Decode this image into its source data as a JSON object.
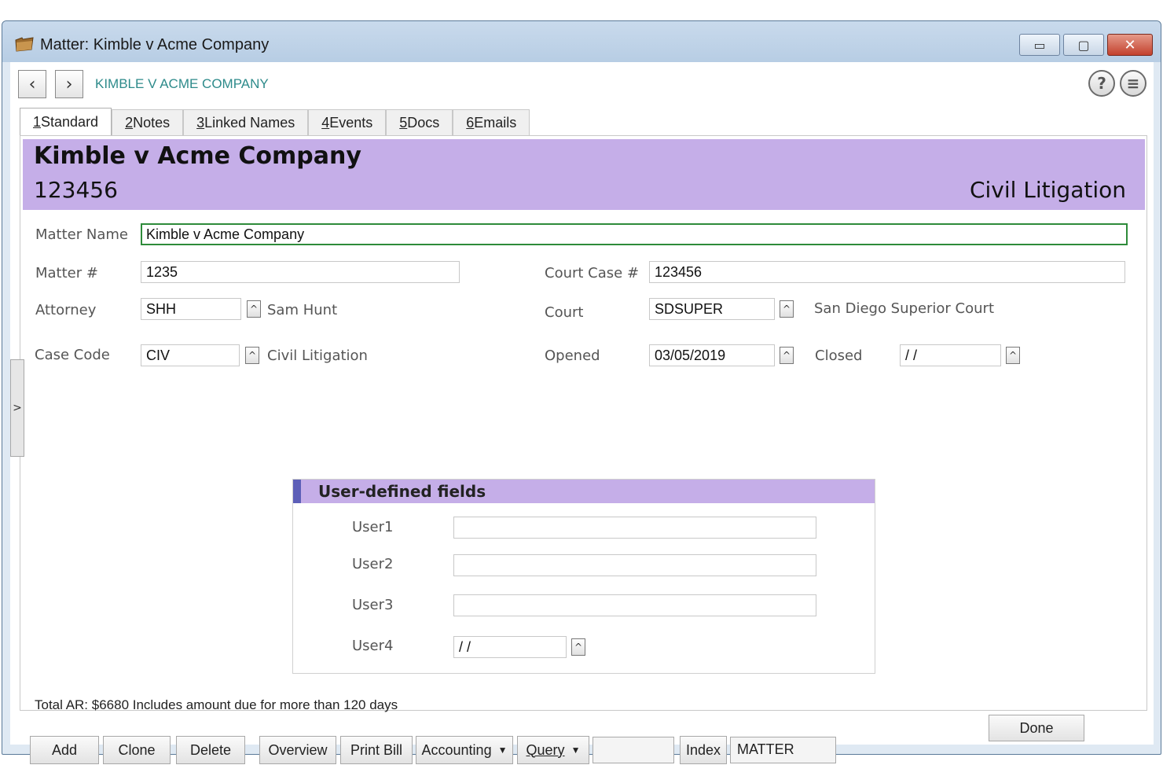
{
  "window": {
    "title": "Matter: Kimble v Acme Company",
    "min_glyph": "▭",
    "max_glyph": "▢",
    "close_glyph": "✕"
  },
  "nav": {
    "prev_glyph": "‹",
    "next_glyph": "›",
    "breadcrumb": "KIMBLE V ACME COMPANY",
    "help_glyph": "?",
    "menu_glyph": "≡"
  },
  "tabs": [
    {
      "key": "1",
      "label": "Standard"
    },
    {
      "key": "2",
      "label": "Notes"
    },
    {
      "key": "3",
      "label": "Linked Names"
    },
    {
      "key": "4",
      "label": "Events"
    },
    {
      "key": "5",
      "label": "Docs"
    },
    {
      "key": "6",
      "label": "Emails"
    }
  ],
  "header": {
    "title": "Kimble v Acme Company",
    "number": "123456",
    "case_type": "Civil Litigation"
  },
  "form": {
    "matter_name_label": "Matter Name",
    "matter_name_value": "Kimble v Acme Company",
    "matter_no_label": "Matter #",
    "matter_no_value": "1235",
    "court_case_label": "Court Case #",
    "court_case_value": "123456",
    "attorney_label": "Attorney",
    "attorney_value": "SHH",
    "attorney_desc": "Sam Hunt",
    "court_label": "Court",
    "court_value": "SDSUPER",
    "court_desc": "San Diego Superior Court",
    "case_code_label": "Case Code",
    "case_code_value": "CIV",
    "case_code_desc": "Civil Litigation",
    "opened_label": "Opened",
    "opened_value": "03/05/2019",
    "closed_label": "Closed",
    "closed_value": " / /",
    "lookup_glyph": "^"
  },
  "udf": {
    "title": "User-defined fields",
    "user1_label": "User1",
    "user1_value": "",
    "user2_label": "User2",
    "user2_value": "",
    "user3_label": "User3",
    "user3_value": "",
    "user4_label": "User4",
    "user4_value": " / /"
  },
  "status": {
    "total_ar": "Total AR: $6680 Includes amount due for more than 120 days"
  },
  "toolbar": {
    "add": "Add",
    "clone": "Clone",
    "delete": "Delete",
    "overview": "Overview",
    "print_bill": "Print Bill",
    "accounting": "Accounting",
    "query": "Query",
    "query_value": "",
    "index": "Index",
    "index_value": "MATTER",
    "caret": "▼",
    "done": "Done"
  },
  "side_tab_glyph": ">"
}
